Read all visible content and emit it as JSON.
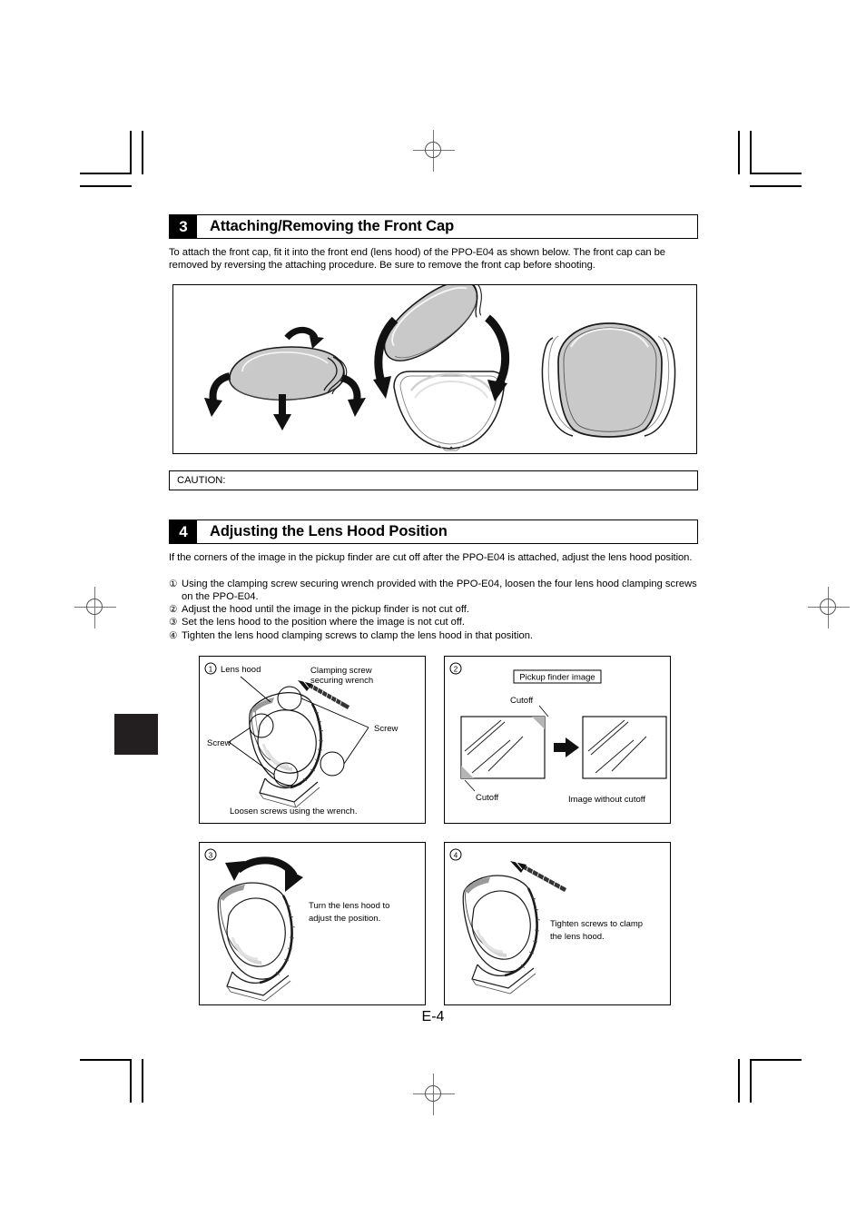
{
  "document": {
    "page_number": "E-4"
  },
  "section3": {
    "number": "3",
    "title": "Attaching/Removing the Front Cap",
    "paragraph": "To attach the front cap, fit it into the front end (lens hood) of the PPO-E04 as shown below. The front cap can be removed by reversing the attaching procedure. Be sure to remove the front cap before shooting.",
    "caution_label": "CAUTION:"
  },
  "section4": {
    "number": "4",
    "title": "Adjusting the Lens Hood Position",
    "paragraph": "If the corners of the image in the pickup finder are cut off after the PPO-E04 is attached, adjust the lens hood position.",
    "steps": [
      {
        "num": "①",
        "text": "Using the clamping screw securing wrench provided with the PPO-E04, loosen the four lens hood clamping screws on the PPO-E04."
      },
      {
        "num": "②",
        "text": "Adjust the hood until the image in the pickup finder is not cut off."
      },
      {
        "num": "③",
        "text": "Set the lens hood to the position where the image is not cut off."
      },
      {
        "num": "④",
        "text": "Tighten the lens hood clamping screws to clamp the lens hood in that position."
      }
    ]
  },
  "figures": {
    "panel1": {
      "marker": "①",
      "label_lens_hood": "Lens hood",
      "label_wrench_line1": "Clamping screw",
      "label_wrench_line2": "securing wrench",
      "label_screw_left": "Screw",
      "label_screw_right": "Screw",
      "caption": "Loosen screws using the wrench."
    },
    "panel2": {
      "marker": "②",
      "title_box": "Pickup finder image",
      "label_cutoff_top": "Cutoff",
      "label_cutoff_bottom": "Cutoff",
      "caption_right": "Image without cutoff"
    },
    "panel3": {
      "marker": "③",
      "caption_line1": "Turn the lens hood to",
      "caption_line2": "adjust the position."
    },
    "panel4": {
      "marker": "④",
      "caption_line1": "Tighten screws to clamp",
      "caption_line2": "the lens hood."
    }
  },
  "colors": {
    "ink": "#000000",
    "fill_gray": "#c9c9c9",
    "tab_black": "#231f20"
  }
}
